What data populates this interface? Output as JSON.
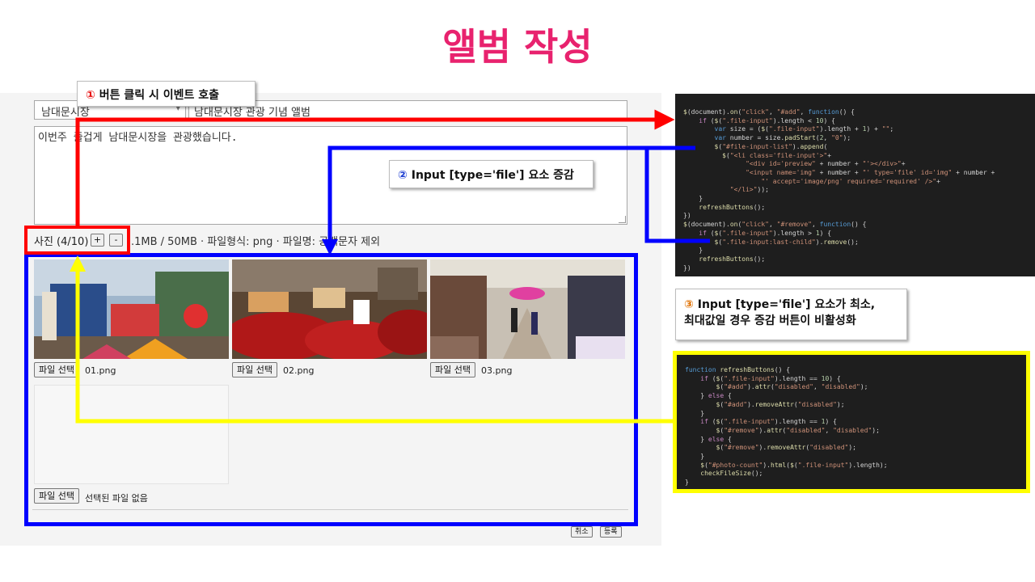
{
  "page": {
    "title": "앨범 작성"
  },
  "form": {
    "category_value": "남대문시장",
    "subject_value": "남대문시장 관광 기념 앨범",
    "body_text": "이번주 즐겁게 남대문시장을 관광했습니다.",
    "photo_label": "사진 (4/10)",
    "add_button": "+",
    "remove_button": "-",
    "limit_info": ".1MB / 50MB · 파일형식: png · 파일명: 공백문자 제외"
  },
  "photos": [
    {
      "button": "파일 선택",
      "filename": "01.png"
    },
    {
      "button": "파일 선택",
      "filename": "02.png"
    },
    {
      "button": "파일 선택",
      "filename": "03.png"
    },
    {
      "button": "파일 선택",
      "filename": "선택된 파일 없음"
    }
  ],
  "footer": {
    "cancel": "취소",
    "submit": "등록"
  },
  "annotations": {
    "callout1": {
      "num": "①",
      "text": "버튼 클릭 시 이벤트 호출"
    },
    "callout2": {
      "num": "②",
      "text": "Input [type='file'] 요소 증감"
    },
    "callout3": {
      "num": "③",
      "line1": "Input [type='file'] 요소가 최소,",
      "line2": "최대값일 경우 증감 버튼이 비활성화"
    }
  },
  "colors": {
    "title": "#e8226e",
    "red": "#ff0000",
    "blue": "#0000ff",
    "yellow": "#ffff00"
  }
}
